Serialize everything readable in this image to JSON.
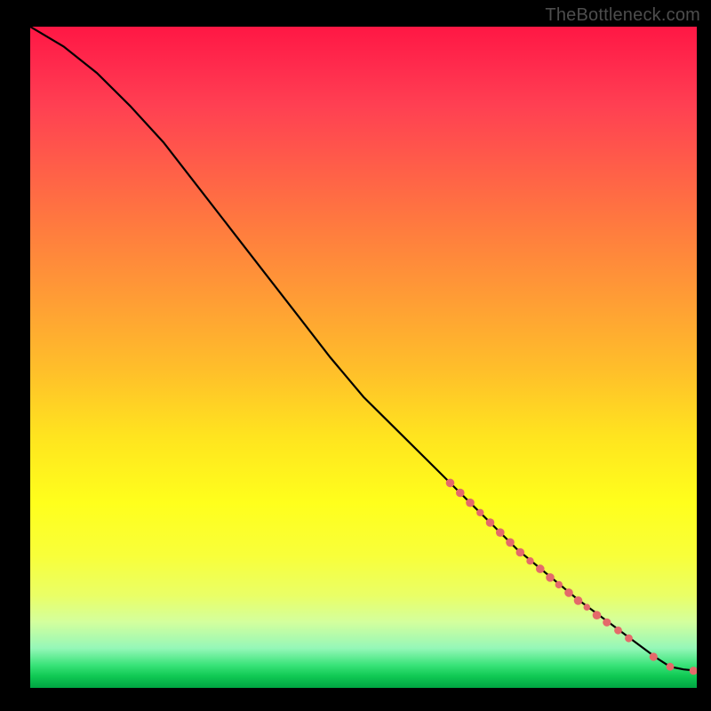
{
  "credit": "TheBottleneck.com",
  "chart_data": {
    "type": "line",
    "title": "",
    "xlabel": "",
    "ylabel": "",
    "xlim": [
      0,
      100
    ],
    "ylim": [
      0,
      100
    ],
    "grid": false,
    "legend": false,
    "series": [
      {
        "name": "curve",
        "x": [
          0,
          5,
          10,
          15,
          20,
          25,
          30,
          35,
          40,
          45,
          50,
          55,
          60,
          63,
          66,
          70,
          73,
          76,
          79,
          82,
          84,
          86,
          88,
          90,
          92,
          94,
          96,
          98,
          100
        ],
        "y": [
          100,
          97,
          93,
          88,
          82.5,
          76,
          69.5,
          63,
          56.5,
          50,
          44,
          39,
          34,
          31,
          28,
          24,
          21,
          18.5,
          16,
          13.5,
          12,
          10.5,
          9,
          7.5,
          6,
          4.5,
          3.2,
          2.8,
          2.6
        ]
      }
    ],
    "markers": [
      {
        "x": 63.0,
        "y": 31.0,
        "r": 4.8
      },
      {
        "x": 64.5,
        "y": 29.5,
        "r": 4.8
      },
      {
        "x": 66.0,
        "y": 28.0,
        "r": 4.8
      },
      {
        "x": 67.5,
        "y": 26.5,
        "r": 4.2
      },
      {
        "x": 69.0,
        "y": 25.0,
        "r": 4.8
      },
      {
        "x": 70.5,
        "y": 23.5,
        "r": 4.8
      },
      {
        "x": 72.0,
        "y": 22.0,
        "r": 4.8
      },
      {
        "x": 73.5,
        "y": 20.5,
        "r": 4.8
      },
      {
        "x": 75.0,
        "y": 19.2,
        "r": 4.2
      },
      {
        "x": 76.5,
        "y": 18.0,
        "r": 4.8
      },
      {
        "x": 78.0,
        "y": 16.7,
        "r": 4.8
      },
      {
        "x": 79.3,
        "y": 15.6,
        "r": 4.2
      },
      {
        "x": 80.8,
        "y": 14.4,
        "r": 4.8
      },
      {
        "x": 82.2,
        "y": 13.2,
        "r": 4.8
      },
      {
        "x": 83.5,
        "y": 12.2,
        "r": 3.8
      },
      {
        "x": 85.0,
        "y": 11.0,
        "r": 4.8
      },
      {
        "x": 86.5,
        "y": 9.9,
        "r": 4.6
      },
      {
        "x": 88.2,
        "y": 8.7,
        "r": 4.4
      },
      {
        "x": 89.8,
        "y": 7.5,
        "r": 4.4
      },
      {
        "x": 93.5,
        "y": 4.7,
        "r": 4.6
      },
      {
        "x": 96.0,
        "y": 3.2,
        "r": 4.4
      },
      {
        "x": 99.5,
        "y": 2.6,
        "r": 4.6
      }
    ],
    "marker_style": {
      "fill": "#e46a6a",
      "stroke": "none"
    }
  }
}
